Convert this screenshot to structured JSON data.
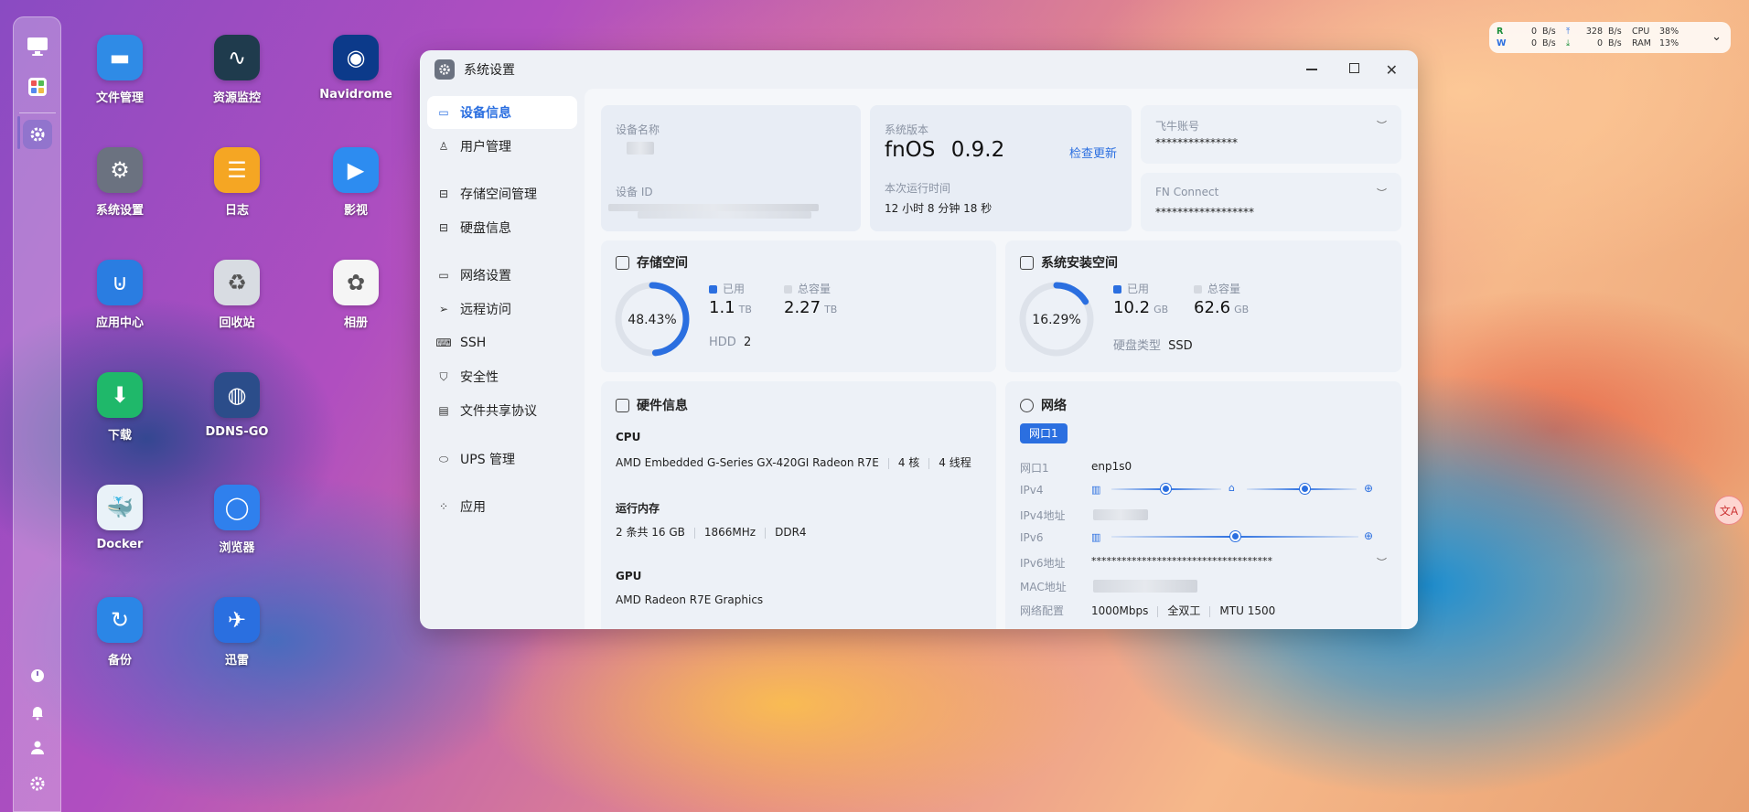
{
  "dock": {
    "top_items": [
      {
        "name": "desktop-icon"
      },
      {
        "name": "apps-grid-icon"
      },
      {
        "name": "settings-app-icon"
      }
    ],
    "bottom_items": [
      {
        "name": "power-icon"
      },
      {
        "name": "bell-icon"
      },
      {
        "name": "user-icon"
      },
      {
        "name": "gear-icon"
      }
    ]
  },
  "desktop_apps": [
    {
      "label": "文件管理",
      "color": "#2f8be6",
      "icon": "folder-icon",
      "glyph": "▬"
    },
    {
      "label": "资源监控",
      "color": "#1f3b4d",
      "icon": "monitor-icon",
      "glyph": "∿"
    },
    {
      "label": "Navidrome",
      "color": "#0c3a8a",
      "icon": "vinyl-icon",
      "glyph": "◉"
    },
    {
      "label": "系统设置",
      "color": "#6b7280",
      "icon": "settings-icon",
      "glyph": "⚙"
    },
    {
      "label": "日志",
      "color": "#f5a623",
      "icon": "log-icon",
      "glyph": "☰"
    },
    {
      "label": "影视",
      "color": "#2d8cf0",
      "icon": "video-icon",
      "glyph": "▶"
    },
    {
      "label": "应用中心",
      "color": "#2a7de1",
      "icon": "store-icon",
      "glyph": "⊍"
    },
    {
      "label": "回收站",
      "color": "#d8dce2",
      "icon": "recycle-icon",
      "glyph": "♻"
    },
    {
      "label": "相册",
      "color": "#f5f5f5",
      "icon": "photos-icon",
      "glyph": "✿"
    },
    {
      "label": "下载",
      "color": "#1fb86a",
      "icon": "download-icon",
      "glyph": "⬇"
    },
    {
      "label": "DDNS-GO",
      "color": "#2b4d8a",
      "icon": "ddns-icon",
      "glyph": "◍"
    },
    {
      "label": "",
      "color": "",
      "icon": "",
      "glyph": ""
    },
    {
      "label": "Docker",
      "color": "#e9f2f8",
      "icon": "docker-icon",
      "glyph": "🐳"
    },
    {
      "label": "浏览器",
      "color": "#2f80ed",
      "icon": "browser-icon",
      "glyph": "◯"
    },
    {
      "label": "",
      "color": "",
      "icon": "",
      "glyph": ""
    },
    {
      "label": "备份",
      "color": "#2b86e6",
      "icon": "backup-icon",
      "glyph": "↻"
    },
    {
      "label": "迅雷",
      "color": "#2a6fe0",
      "icon": "xunlei-icon",
      "glyph": "✈"
    }
  ],
  "monitor": {
    "r_label": "R",
    "w_label": "W",
    "r_val": "0",
    "w_val": "0",
    "unit": "B/s",
    "up_val": "328",
    "down_val": "0",
    "cpu_label": "CPU",
    "cpu_val": "38%",
    "ram_label": "RAM",
    "ram_val": "13%"
  },
  "window": {
    "title": "系统设置",
    "nav": [
      {
        "label": "设备信息",
        "icon": "device-icon",
        "glyph": "▭",
        "active": true
      },
      {
        "label": "用户管理",
        "icon": "user-icon",
        "glyph": "♙",
        "active": false
      },
      {
        "label": "存储空间管理",
        "icon": "storage-icon",
        "glyph": "⊟",
        "active": false
      },
      {
        "label": "硬盘信息",
        "icon": "disk-icon",
        "glyph": "⊟",
        "active": false
      },
      {
        "label": "网络设置",
        "icon": "network-icon",
        "glyph": "▭",
        "active": false
      },
      {
        "label": "远程访问",
        "icon": "remote-icon",
        "glyph": "➢",
        "active": false
      },
      {
        "label": "SSH",
        "icon": "ssh-icon",
        "glyph": "⌨",
        "active": false
      },
      {
        "label": "安全性",
        "icon": "shield-icon",
        "glyph": "⛉",
        "active": false
      },
      {
        "label": "文件共享协议",
        "icon": "file-share-icon",
        "glyph": "▤",
        "active": false
      },
      {
        "label": "UPS 管理",
        "icon": "ups-icon",
        "glyph": "⬭",
        "active": false
      },
      {
        "label": "应用",
        "icon": "apps-icon",
        "glyph": "⁘",
        "active": false
      }
    ]
  },
  "device": {
    "name_label": "设备名称",
    "id_label": "设备 ID",
    "version_label": "系统版本",
    "os_name": "fnOS",
    "os_version": "0.9.2",
    "check_update": "检查更新",
    "uptime_label": "本次运行时间",
    "uptime": "12 小时 8 分钟 18 秒",
    "account_label": "飞牛账号",
    "account_value": "***************",
    "fnconnect_label": "FN Connect",
    "fnconnect_value": "******************"
  },
  "storage": {
    "title": "存储空间",
    "percent_text": "48.43%",
    "percent": 48.43,
    "used_label": "已用",
    "used": "1.1",
    "used_unit": "TB",
    "total_label": "总容量",
    "total": "2.27",
    "total_unit": "TB",
    "hdd_label": "HDD",
    "hdd_count": "2"
  },
  "system_space": {
    "title": "系统安装空间",
    "percent_text": "16.29%",
    "percent": 16.29,
    "used_label": "已用",
    "used": "10.2",
    "used_unit": "GB",
    "total_label": "总容量",
    "total": "62.6",
    "total_unit": "GB",
    "disk_type_label": "硬盘类型",
    "disk_type": "SSD"
  },
  "hardware": {
    "title": "硬件信息",
    "cpu_label": "CPU",
    "cpu_model": "AMD Embedded G-Series GX-420GI Radeon R7E",
    "cpu_cores": "4 核",
    "cpu_threads": "4 线程",
    "mem_label": "运行内存",
    "mem_size": "2 条共 16 GB",
    "mem_freq": "1866MHz",
    "mem_type": "DDR4",
    "gpu_label": "GPU",
    "gpu_model": "AMD Radeon R7E Graphics"
  },
  "network": {
    "title": "网络",
    "tab": "网口1",
    "port_label": "网口1",
    "port_value": "enp1s0",
    "ipv4_label": "IPv4",
    "ipv4_addr_label": "IPv4地址",
    "ipv6_label": "IPv6",
    "ipv6_addr_label": "IPv6地址",
    "ipv6_addr_value": "************************************",
    "mac_label": "MAC地址",
    "config_label": "网络配置",
    "speed": "1000Mbps",
    "duplex": "全双工",
    "mtu": "MTU 1500"
  },
  "colors": {
    "accent": "#2b6fe0",
    "ring_track": "#dde2ea"
  }
}
